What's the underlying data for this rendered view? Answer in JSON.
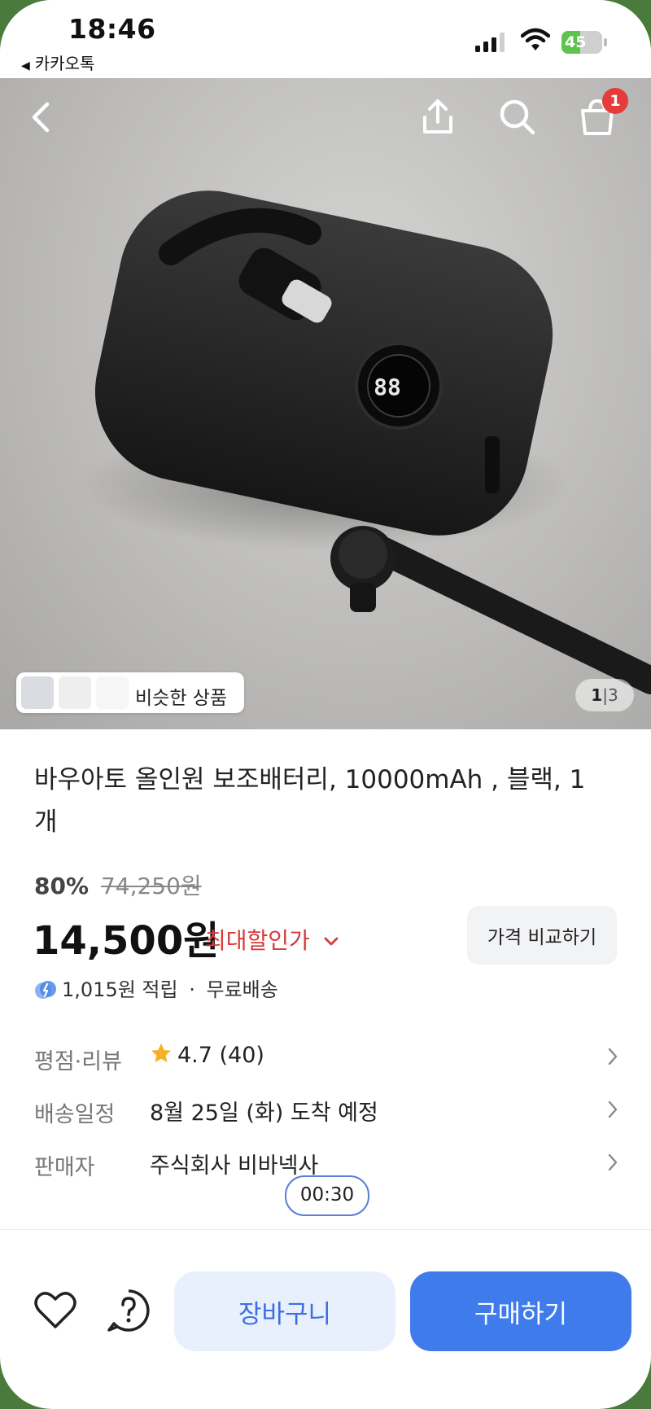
{
  "status_bar": {
    "time": "18:46",
    "back_app": "카카오톡",
    "battery": "45",
    "battery_level": 0.45,
    "battery_color": "#5cc44a"
  },
  "nav": {
    "back_icon": "chevron-left-icon",
    "share_icon": "share-icon",
    "search_icon": "search-icon",
    "cart_icon": "shopping-bag-icon",
    "cart_badge": "1"
  },
  "gallery": {
    "similar_label": "비슷한 상품",
    "page_current": "1",
    "page_total": "3"
  },
  "product": {
    "title": "바우아토 올인원 보조배터리, 10000mAh , 블랙, 1개",
    "discount_rate": "80%",
    "original_price": "74,250원",
    "price": "14,500원",
    "max_discount_label": "최대할인가",
    "compare_button": "가격 비교하기",
    "points": "1,015원 적립",
    "shipping": "무료배송",
    "separator": "·"
  },
  "details": [
    {
      "key": "평점·리뷰",
      "value": "4.7 (40)"
    },
    {
      "key": "배송일정",
      "value": "8월 25일 (화) 도착 예정"
    },
    {
      "key": "판매자",
      "value": "주식회사 비바넥사"
    }
  ],
  "timer": "00:30",
  "bottom_bar": {
    "wish_icon": "heart-icon",
    "help_icon": "question-circle-icon",
    "cart_button": "장바구니",
    "buy_button": "구매하기"
  },
  "colors": {
    "accent": "#3f7bea",
    "discount_red": "#d63a3a",
    "badge_red": "#e53b3b",
    "star": "#f5b027"
  }
}
